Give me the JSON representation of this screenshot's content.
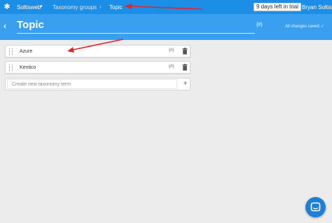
{
  "topbar": {
    "project": "Soltisweb",
    "breadcrumb": [
      "Taxonomy groups",
      "Topic"
    ],
    "trial": "9 days left in trial",
    "user": "Bryan Soltis"
  },
  "header": {
    "title": "Topic",
    "codename_icon": "{#}",
    "status": "All changes saved"
  },
  "terms": [
    {
      "name": "Azure",
      "code_icon": "{#}"
    },
    {
      "name": "Kentico",
      "code_icon": "{#}"
    }
  ],
  "new_term": {
    "placeholder": "Create new taxonomy term",
    "add_label": "+"
  },
  "colors": {
    "topbar": "#1d8ee6",
    "header": "#3b9ff0",
    "background": "#ececec",
    "annotation_arrow": "#e0262b",
    "chat": "#1e7fd6"
  }
}
